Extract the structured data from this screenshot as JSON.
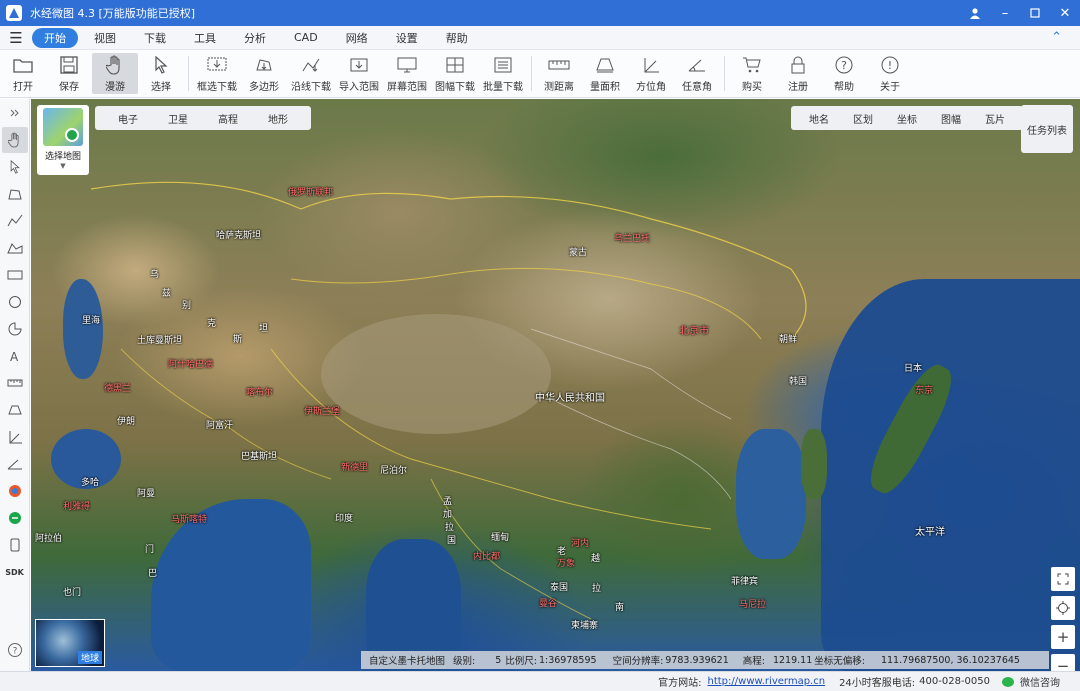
{
  "window": {
    "title": "水经微图 4.3 [万能版功能已授权]"
  },
  "menu": {
    "items": [
      "开始",
      "视图",
      "下载",
      "工具",
      "分析",
      "CAD",
      "网络",
      "设置",
      "帮助"
    ]
  },
  "toolbar": {
    "items": [
      "打开",
      "保存",
      "漫游",
      "选择",
      "框选下载",
      "多边形",
      "沿线下载",
      "导入范围",
      "屏幕范围",
      "图幅下载",
      "批量下载",
      "测距离",
      "量面积",
      "方位角",
      "任意角",
      "购买",
      "注册",
      "帮助",
      "关于"
    ]
  },
  "sidebar": {
    "sdk_label": "SDK"
  },
  "map": {
    "chooser_label": "选择地图",
    "layer_tabs": [
      "电子",
      "卫星",
      "高程",
      "地形"
    ],
    "overlay_tabs": [
      "地名",
      "区划",
      "坐标",
      "图幅",
      "瓦片"
    ],
    "task_list": "任务列表",
    "globe_label": "地球",
    "labels": {
      "russia": "俄罗斯联邦",
      "kazakhstan": "哈萨克斯坦",
      "mongolia": "蒙古",
      "mongolia_capital": "乌兰巴托",
      "caspian": "里海",
      "uzbek1": "乌",
      "uzbek2": "兹",
      "uzbek3": "别",
      "kyrgyz": "克",
      "tajik": "坦",
      "xinjiang": "斯",
      "turkmen": "土库曼斯坦",
      "ashgabat": "阿什哈巴德",
      "tehran": "德黑兰",
      "afghanistan": "阿富汗",
      "kabul": "喀布尔",
      "islamabad": "伊斯兰堡",
      "iran": "伊朗",
      "pakistan": "巴基斯坦",
      "china": "中华人民共和国",
      "beijing": "北京市",
      "dprk": "朝鲜",
      "rok": "韩国",
      "japan": "日本",
      "tokyo": "东京",
      "nepal": "尼泊尔",
      "delhi": "新德里",
      "india": "印度",
      "bangladesh1": "孟",
      "bangladesh2": "加",
      "bangladesh3": "拉",
      "bangladesh4": "国",
      "myanmar": "缅甸",
      "naypyidaw": "内比都",
      "laos": "老",
      "vientiane": "万象",
      "vietnam": "越",
      "hanoi": "河内",
      "thailand": "泰国",
      "bangkok": "曼谷",
      "cambodia": "柬埔寨",
      "cambodia_mark": "拉",
      "south": "南",
      "philippines": "菲律宾",
      "manila": "马尼拉",
      "pacific": "太平洋",
      "doha": "多哈",
      "riyadh": "利雅得",
      "muscat": "马斯喀特",
      "oman": "阿曼",
      "uae": "阿拉伯",
      "yemen": "门",
      "world": "也门",
      "pakistan2": "巴"
    },
    "status": {
      "map_name": "自定义墨卡托地图",
      "level_label": "级别:",
      "level": "5",
      "scale_label": "比例尺:",
      "scale": "1:36978595",
      "resolution_label": "空间分辨率:",
      "resolution": "9783.939621",
      "elevation_label": "高程:",
      "elevation": "1219.11",
      "coord_label": "坐标无偏移:",
      "coords": "111.79687500, 36.10237645"
    }
  },
  "footer": {
    "site_label": "官方网站:",
    "site_url": "http://www.rivermap.cn",
    "phone_label": "24小时客服电话:",
    "phone": "400-028-0050",
    "wechat": "微信咨询"
  }
}
